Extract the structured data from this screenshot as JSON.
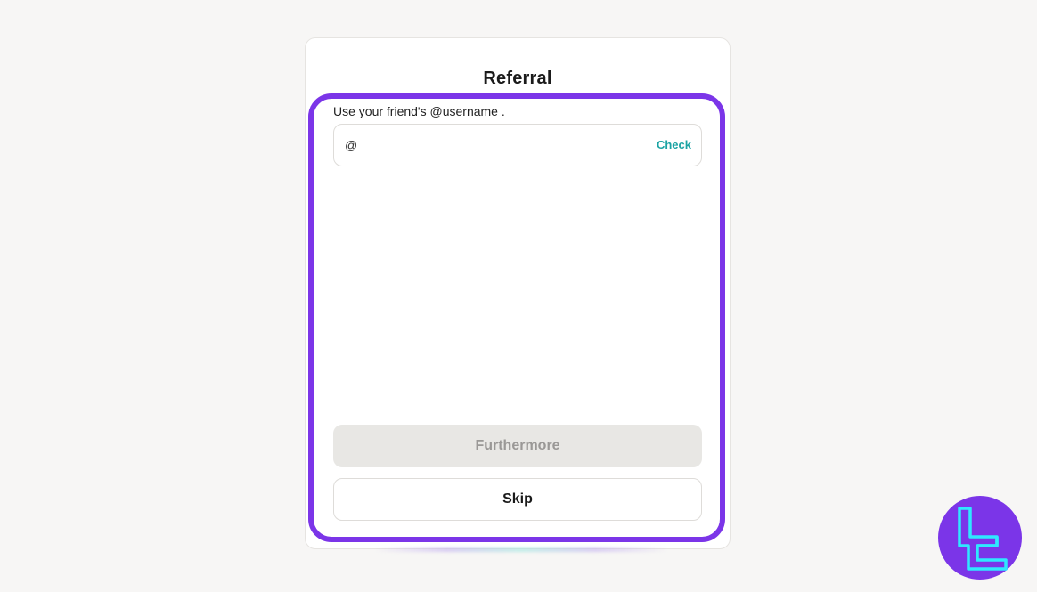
{
  "dialog": {
    "title": "Referral",
    "hint": "Use your friend's @username .",
    "input": {
      "prefix": "@",
      "value": "",
      "placeholder": "",
      "action_label": "Check"
    },
    "primary_button_label": "Furthermore",
    "secondary_button_label": "Skip"
  },
  "colors": {
    "highlight": "#7b35e8",
    "accent": "#1aa3a3",
    "logo_bg": "#7b35e8",
    "logo_stroke": "#2ee8ff"
  },
  "icons": {
    "watermark": "tradingfinder-logo-icon"
  }
}
